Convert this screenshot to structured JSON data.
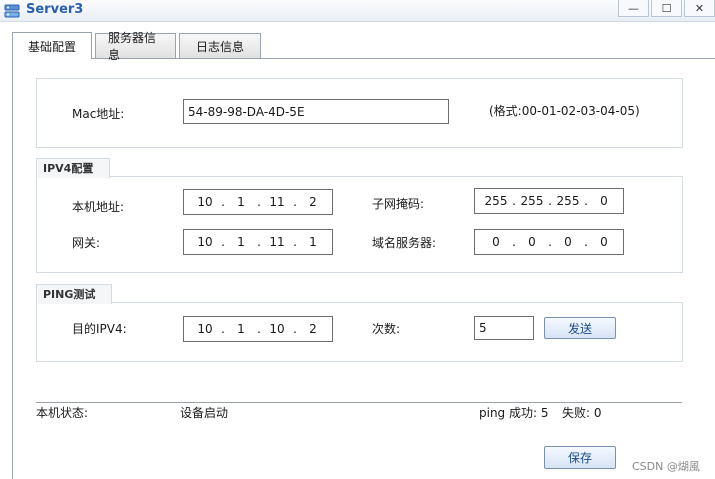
{
  "window": {
    "title": "Server3",
    "minimize": "—",
    "maximize": "☐",
    "close": "✕"
  },
  "tabs": [
    "基础配置",
    "服务器信息",
    "日志信息"
  ],
  "mac": {
    "label": "Mac地址:",
    "value": "54-89-98-DA-4D-5E",
    "format_hint": "(格式:00-01-02-03-04-05)"
  },
  "ipv4": {
    "legend": "IPV4配置",
    "local_ip_label": "本机地址:",
    "local_ip": [
      "10",
      "1",
      "11",
      "2"
    ],
    "mask_label": "子网掩码:",
    "mask": [
      "255",
      "255",
      "255",
      "0"
    ],
    "gateway_label": "网关:",
    "gateway": [
      "10",
      "1",
      "11",
      "1"
    ],
    "dns_label": "域名服务器:",
    "dns": [
      "0",
      "0",
      "0",
      "0"
    ]
  },
  "ping": {
    "legend": "PING测试",
    "dest_label": "目的IPV4:",
    "dest": [
      "10",
      "1",
      "10",
      "2"
    ],
    "count_label": "次数:",
    "count": "5",
    "send_label": "发送"
  },
  "status": {
    "label": "本机状态:",
    "value": "设备启动",
    "ping_success": "ping 成功: 5",
    "fail": "失败: 0"
  },
  "save_label": "保存",
  "watermark": "CSDN @煳風",
  "colors": {
    "title": "#2a5fae",
    "button_text": "#1b4c8c"
  }
}
